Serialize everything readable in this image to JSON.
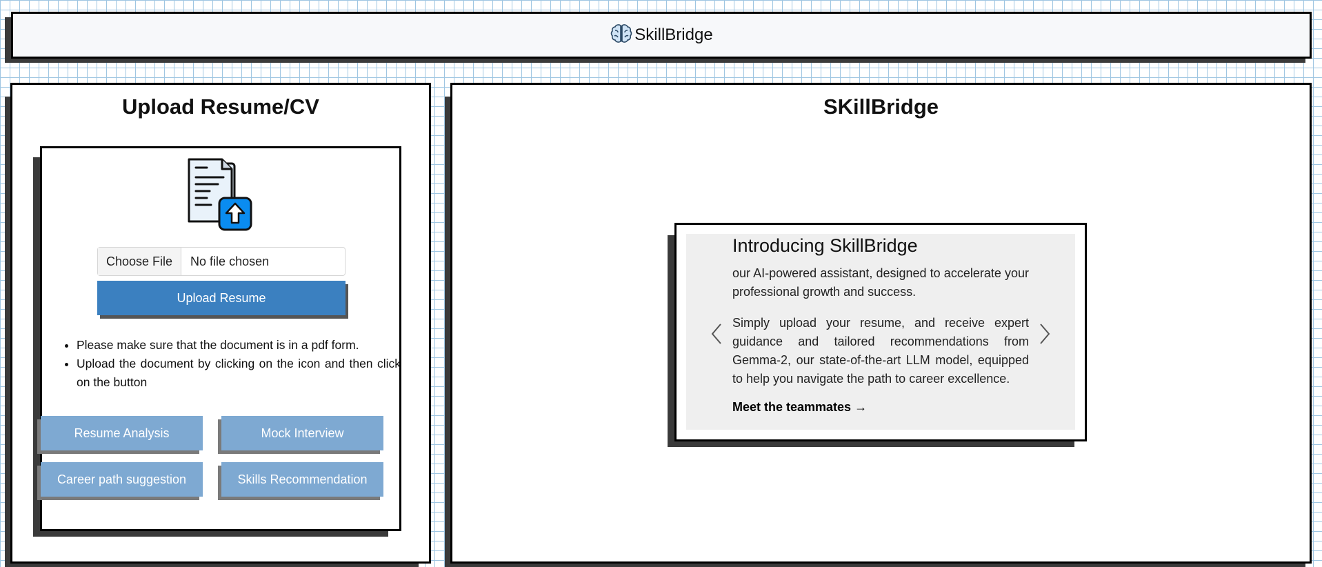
{
  "header": {
    "brand": "SkillBridge",
    "logo_icon": "brain-icon"
  },
  "left_panel": {
    "title": "Upload Resume/CV",
    "upload_icon": "document-upload-icon",
    "file_input": {
      "button_label": "Choose File",
      "status": "No file chosen"
    },
    "upload_button": "Upload Resume",
    "notes": [
      "Please make sure that the document is in a pdf form.",
      "Upload the document by clicking on the icon and then click on the button"
    ],
    "features": [
      "Resume Analysis",
      "Mock Interview",
      "Career path suggestion",
      "Skills Recommendation"
    ]
  },
  "right_panel": {
    "title": "SKillBridge",
    "carousel": {
      "heading": "Introducing SkillBridge",
      "paragraph1": "our AI-powered assistant, designed to accelerate your professional growth and success.",
      "paragraph2": "Simply upload your resume, and receive expert guidance and tailored recommendations from Gemma-2, our state-of-the-art LLM model, equipped to help you navigate the path to career excellence.",
      "link": "Meet the teammates →",
      "prev_icon": "chevron-left-icon",
      "next_icon": "chevron-right-icon"
    }
  },
  "colors": {
    "primary_button": "#3b80c0",
    "feature_button": "#7ea9d2",
    "grid_line": "#9fc6e2",
    "slide_bg": "#efefef"
  }
}
